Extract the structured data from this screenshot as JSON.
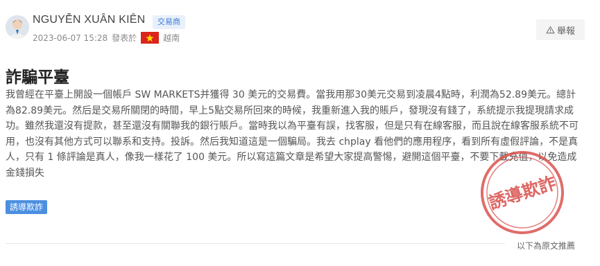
{
  "user": {
    "name": "NGUYỄN XUÂN KIÊN",
    "role_badge": "交易商",
    "date": "2023-06-07 15:28",
    "posted_in_label": "發表於",
    "country": "越南"
  },
  "report_button": {
    "label": "舉報",
    "icon": "warning-triangle-icon"
  },
  "post": {
    "title": "詐騙平臺",
    "body": "我曾經在平臺上開設一個帳戶 SW MARKETS并獲得 30 美元的交易費。當我用那30美元交易到凌晨4點時，利潤為52.89美元。總計為82.89美元。然后是交易所關閉的時間，早上5點交易所回來的時候，我重新進入我的賬戶，發現沒有錢了，系統提示我提現請求成功。雖然我還沒有提款，甚至還沒有關聯我的銀行賬戶。當時我以為平臺有誤，找客服，但是只有在線客服，而且說在線客服系統不可用，也沒有其他方式可以聯系和支持。投訴。然后我知道這是一個騙局。我去 chplay 看他們的應用程序，看到所有虛假評論，不是真人，只有 1 條評論是真人，像我一樣花了 100 美元。所以寫這篇文章是希望大家提高警惕，避開這個平臺，不要下載充值，以免造成金錢損失",
    "tag": "誘導欺詐",
    "stamp_text": "誘導欺詐"
  },
  "footer": {
    "note": "以下為原文推薦"
  },
  "colors": {
    "accent": "#4b8fe0",
    "stamp": "#d9534f"
  }
}
